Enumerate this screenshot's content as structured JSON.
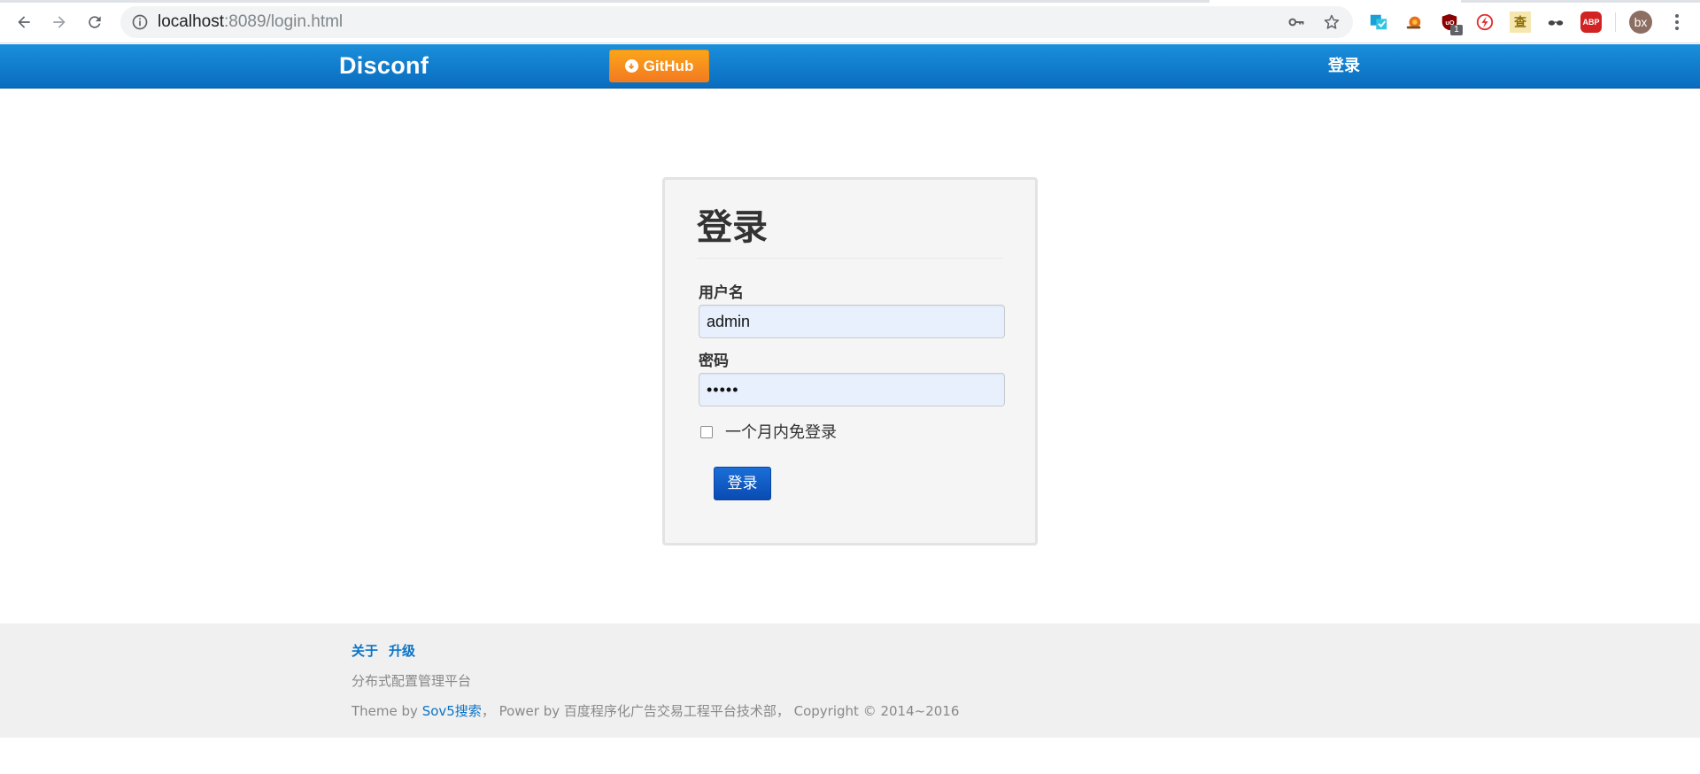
{
  "browser": {
    "url_host": "localhost",
    "url_rest": ":8089/login.html",
    "extension_badge": "1",
    "extension_cha_glyph": "查",
    "extension_abp_label": "ABP",
    "profile_initials": "bx"
  },
  "navbar": {
    "brand": "Disconf",
    "github_label": "GitHub",
    "login_link": "登录"
  },
  "login": {
    "title": "登录",
    "username_label": "用户名",
    "username_value": "admin",
    "password_label": "密码",
    "password_value": "•••••",
    "remember_label": "一个月内免登录",
    "remember_checked": false,
    "submit_label": "登录"
  },
  "footer": {
    "links": [
      "关于",
      "升级"
    ],
    "tagline": "分布式配置管理平台",
    "theme_prefix": "Theme by ",
    "theme_link": "Sov5搜索",
    "power_text": "， Power by 百度程序化广告交易工程平台技术部， Copyright © 2014~2016"
  },
  "colors": {
    "navbar": "#1a8fdc",
    "github_button": "#f48a1c",
    "submit_button": "#0a5cc4",
    "link": "#0a73c6",
    "autofill_input": "#e8f0fe"
  }
}
